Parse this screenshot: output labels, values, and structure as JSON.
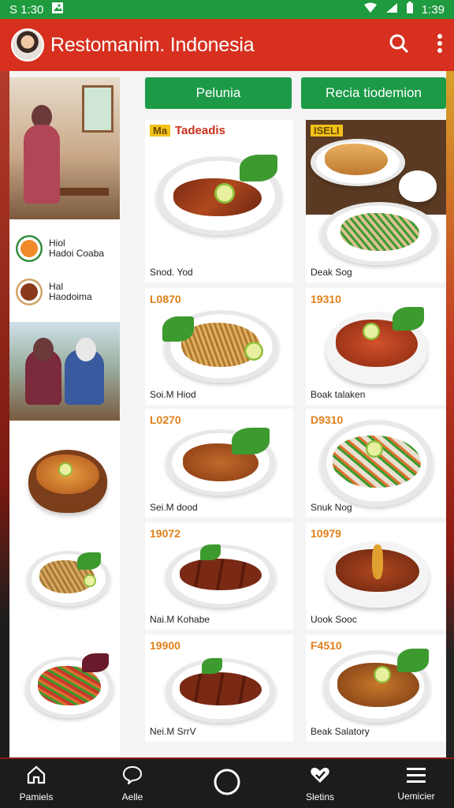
{
  "status_bar": {
    "left_text": "S 1:30",
    "time": "1:39"
  },
  "app_bar": {
    "title": "Restomanim. Indonesia",
    "icons": [
      "avatar",
      "search-icon",
      "more-vert-icon"
    ]
  },
  "sidebar": {
    "categories": [
      {
        "line1": "Hiol",
        "line2": "Hadoi Coaba"
      },
      {
        "line1": "Hal",
        "line2": "Haodoima"
      }
    ]
  },
  "tabs": [
    {
      "label": "Pelunia"
    },
    {
      "label": "Recia tiodemion"
    }
  ],
  "menu": {
    "left": [
      {
        "price": "Ma",
        "subtitle": "Tadeadis",
        "name": "Snod. Yod"
      },
      {
        "price": "L0870",
        "name": "Soi.M Hiod"
      },
      {
        "price": "L0270",
        "name": "Sei.M dood"
      },
      {
        "price": "19072",
        "name": "Nai.M Kohabe"
      },
      {
        "price": "19900",
        "name": "Nei.M SrrV"
      }
    ],
    "right": [
      {
        "price": "ISELI",
        "name": "Deak Sog"
      },
      {
        "price": "19310",
        "name": "Boak talaken"
      },
      {
        "price": "D9310",
        "name": "Snuk Nog"
      },
      {
        "price": "10979",
        "name": "Uook Sooc"
      },
      {
        "price": "F4510",
        "name": "Beak Salatory"
      }
    ]
  },
  "bottom_nav": [
    {
      "label": "Pamiels",
      "icon": "home-icon"
    },
    {
      "label": "Aelle",
      "icon": "chat-icon"
    },
    {
      "label": "",
      "icon": "circle-button-icon"
    },
    {
      "label": "Sletins",
      "icon": "heart-check-icon"
    },
    {
      "label": "Uemicier",
      "icon": "menu-icon"
    }
  ],
  "colors": {
    "status": "#1f9a3f",
    "appbar": "#d7301f",
    "tabs": "#1d9a47",
    "nav": "#1c1c1c"
  }
}
